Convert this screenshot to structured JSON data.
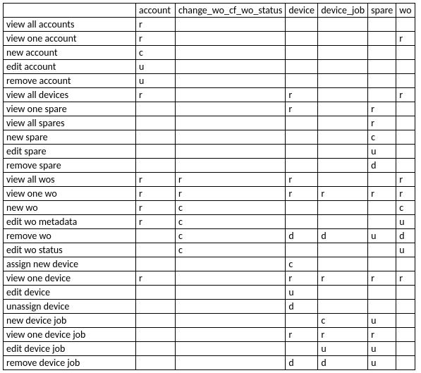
{
  "columns": [
    "",
    "account",
    "change_wo_cf_wo_status",
    "device",
    "device_job",
    "spare",
    "wo"
  ],
  "rows": [
    {
      "label": "view all accounts",
      "cells": [
        "r",
        "",
        "",
        "",
        "",
        ""
      ]
    },
    {
      "label": "view one account",
      "cells": [
        "r",
        "",
        "",
        "",
        "",
        "r"
      ]
    },
    {
      "label": "new account",
      "cells": [
        "c",
        "",
        "",
        "",
        "",
        ""
      ]
    },
    {
      "label": "edit account",
      "cells": [
        "u",
        "",
        "",
        "",
        "",
        ""
      ]
    },
    {
      "label": "remove account",
      "cells": [
        "u",
        "",
        "",
        "",
        "",
        ""
      ]
    },
    {
      "label": "view all devices",
      "cells": [
        "r",
        "",
        "r",
        "",
        "",
        "r"
      ]
    },
    {
      "label": "view one spare",
      "cells": [
        "",
        "",
        "r",
        "",
        "r",
        ""
      ]
    },
    {
      "label": "view all spares",
      "cells": [
        "",
        "",
        "",
        "",
        "r",
        ""
      ]
    },
    {
      "label": "new spare",
      "cells": [
        "",
        "",
        "",
        "",
        "c",
        ""
      ]
    },
    {
      "label": "edit spare",
      "cells": [
        "",
        "",
        "",
        "",
        "u",
        ""
      ]
    },
    {
      "label": "remove spare",
      "cells": [
        "",
        "",
        "",
        "",
        "d",
        ""
      ]
    },
    {
      "label": "view all wos",
      "cells": [
        "r",
        "r",
        "r",
        "",
        "",
        "r"
      ]
    },
    {
      "label": "view one wo",
      "cells": [
        "r",
        "r",
        "r",
        "r",
        "r",
        "r"
      ]
    },
    {
      "label": "new wo",
      "cells": [
        "r",
        "c",
        "",
        "",
        "",
        "c"
      ]
    },
    {
      "label": "edit wo metadata",
      "cells": [
        "r",
        "c",
        "",
        "",
        "",
        "u"
      ]
    },
    {
      "label": "remove wo",
      "cells": [
        "",
        "c",
        "d",
        "d",
        "u",
        "d"
      ]
    },
    {
      "label": "edit wo status",
      "cells": [
        "",
        "c",
        "",
        "",
        "",
        "u"
      ]
    },
    {
      "label": "assign new device",
      "cells": [
        "",
        "",
        "c",
        "",
        "",
        ""
      ]
    },
    {
      "label": "view one device",
      "cells": [
        "r",
        "",
        "r",
        "r",
        "r",
        "r"
      ]
    },
    {
      "label": "edit device",
      "cells": [
        "",
        "",
        "u",
        "",
        "",
        ""
      ]
    },
    {
      "label": "unassign device",
      "cells": [
        "",
        "",
        "d",
        "",
        "",
        ""
      ]
    },
    {
      "label": "new device job",
      "cells": [
        "",
        "",
        "",
        "c",
        "u",
        ""
      ]
    },
    {
      "label": "view one device job",
      "cells": [
        "",
        "",
        "r",
        "r",
        "r",
        ""
      ]
    },
    {
      "label": "edit device job",
      "cells": [
        "",
        "",
        "",
        "u",
        "u",
        ""
      ]
    },
    {
      "label": "remove device job",
      "cells": [
        "",
        "",
        "d",
        "d",
        "u",
        ""
      ]
    }
  ]
}
